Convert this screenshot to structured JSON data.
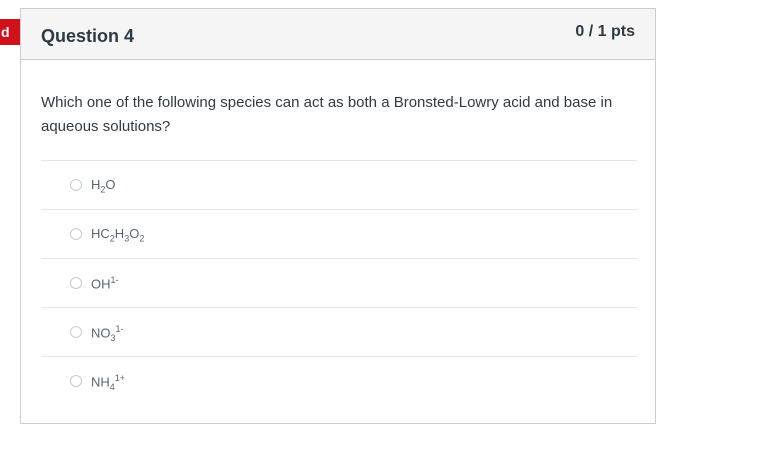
{
  "flag": {
    "label": "d"
  },
  "question": {
    "title": "Question 4",
    "points": "0 / 1 pts",
    "text": "Which one of the following species can act as both a Bronsted-Lowry acid and base in aqueous solutions?"
  },
  "answers": [
    {
      "parts": [
        {
          "t": "H"
        },
        {
          "t": "2",
          "type": "sub"
        },
        {
          "t": "O"
        }
      ]
    },
    {
      "parts": [
        {
          "t": "HC"
        },
        {
          "t": "2",
          "type": "sub"
        },
        {
          "t": "H"
        },
        {
          "t": "3",
          "type": "sub"
        },
        {
          "t": "O"
        },
        {
          "t": "2",
          "type": "sub"
        }
      ]
    },
    {
      "parts": [
        {
          "t": "OH"
        },
        {
          "t": "1-",
          "type": "sup"
        }
      ]
    },
    {
      "parts": [
        {
          "t": "NO"
        },
        {
          "t": "3",
          "type": "sub"
        },
        {
          "t": "1-",
          "type": "sup"
        }
      ]
    },
    {
      "parts": [
        {
          "t": "NH"
        },
        {
          "t": "4",
          "type": "sub"
        },
        {
          "t": "1+",
          "type": "sup"
        }
      ]
    }
  ]
}
